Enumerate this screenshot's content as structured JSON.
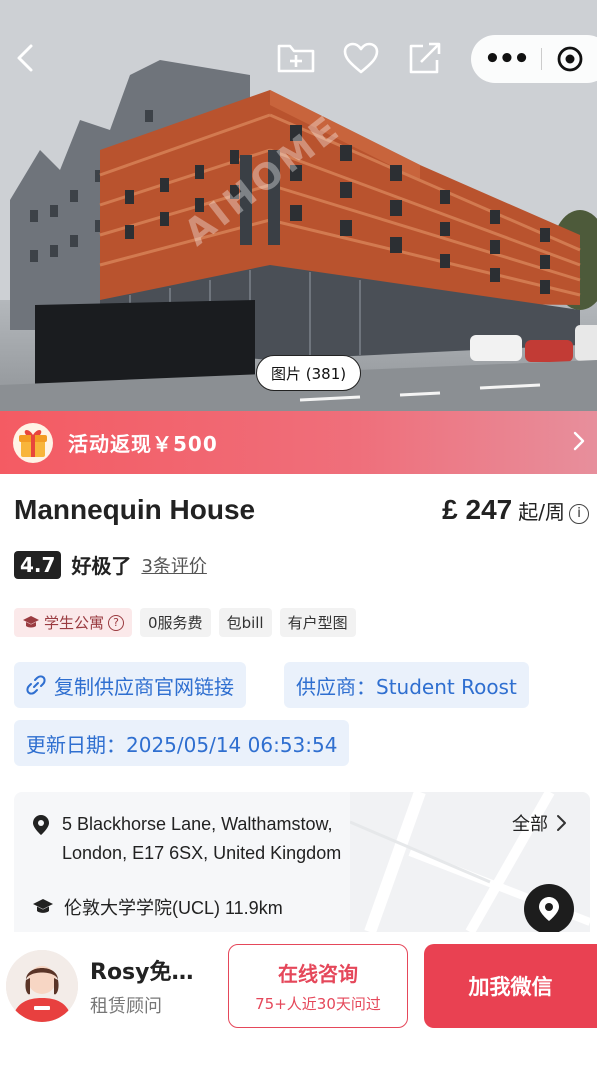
{
  "header": {
    "back_icon": "chevron-left-icon",
    "actions": [
      "folder-add-icon",
      "heart-icon",
      "share-icon"
    ],
    "capsule": {
      "menu": "•••",
      "close_icon": "target-icon"
    },
    "photo_count": "图片 (381)",
    "watermark": "AIHOME"
  },
  "promo": {
    "label": "活动返现￥500",
    "icon": "gift-icon"
  },
  "property": {
    "name": "Mannequin House",
    "price": "£ 247",
    "price_unit": "起/周",
    "rating": "4.7",
    "rating_word": "好极了",
    "reviews": "3条评价",
    "tags": [
      "学生公寓",
      "0服务费",
      "包bill",
      "有户型图"
    ]
  },
  "supplier": {
    "copy_link": "复制供应商官网链接",
    "supplier_label": "供应商：Student Roost",
    "updated": "更新日期：2025/05/14 06:53:54"
  },
  "address": {
    "line1": "5 Blackhorse Lane, Walthamstow,",
    "line2": "London, E17 6SX, United Kingdom",
    "all_label": "全部",
    "university": "伦敦大学学院(UCL) 11.9km"
  },
  "agent": {
    "name": "Rosy免…",
    "role": "租赁顾问",
    "consult_label": "在线咨询",
    "consult_sub": "75+人近30天问过",
    "wechat_label": "加我微信"
  },
  "colors": {
    "accent": "#e94152",
    "link": "#2f6fd0",
    "promo": "#f45b63"
  }
}
